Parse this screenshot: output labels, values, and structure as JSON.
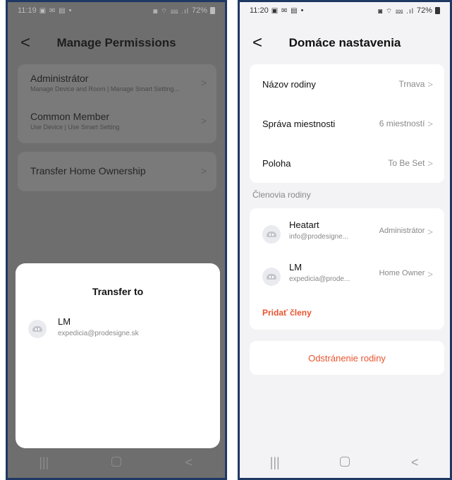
{
  "left": {
    "status": {
      "time": "11:19",
      "icons": "▣ ✉ ▤",
      "dot": "•",
      "right_icons": "◙ ⌔ ⅏ .ıl",
      "battery": "72%"
    },
    "header": {
      "back": "<",
      "title": "Manage Permissions"
    },
    "permissions": [
      {
        "name": "Administrátor",
        "desc": "Manage Device and Room | Manage Smart Setting..."
      },
      {
        "name": "Common Member",
        "desc": "Use Device | Use Smart Setting"
      }
    ],
    "transfer": {
      "label": "Transfer Home Ownership"
    },
    "sheet": {
      "title": "Transfer to",
      "member": {
        "name": "LM",
        "email": "expedicia@prodesigne.sk"
      }
    },
    "nav": {
      "recent": "|||",
      "back": "<"
    }
  },
  "right": {
    "status": {
      "time": "11:20",
      "icons": "▣ ✉ ▤",
      "dot": "•",
      "right_icons": "◙ ⌔ ⅏ .ıl",
      "battery": "72%"
    },
    "header": {
      "back": "<",
      "title": "Domáce nastavenia"
    },
    "settings": [
      {
        "label": "Názov rodiny",
        "value": "Trnava"
      },
      {
        "label": "Správa miestnosti",
        "value": "6 miestností"
      },
      {
        "label": "Poloha",
        "value": "To Be Set"
      }
    ],
    "members_label": "Členovia rodiny",
    "members": [
      {
        "name": "Heatart",
        "email": "info@prodesigne...",
        "role": "Administrátor"
      },
      {
        "name": "LM",
        "email": "expedicia@prode...",
        "role": "Home Owner"
      }
    ],
    "add_members": "Pridať členy",
    "remove_family": "Odstránenie rodiny",
    "nav": {
      "recent": "|||",
      "back": "<"
    }
  },
  "chevron": ">",
  "colors": {
    "accent": "#e8542f",
    "frame": "#1f3864"
  }
}
